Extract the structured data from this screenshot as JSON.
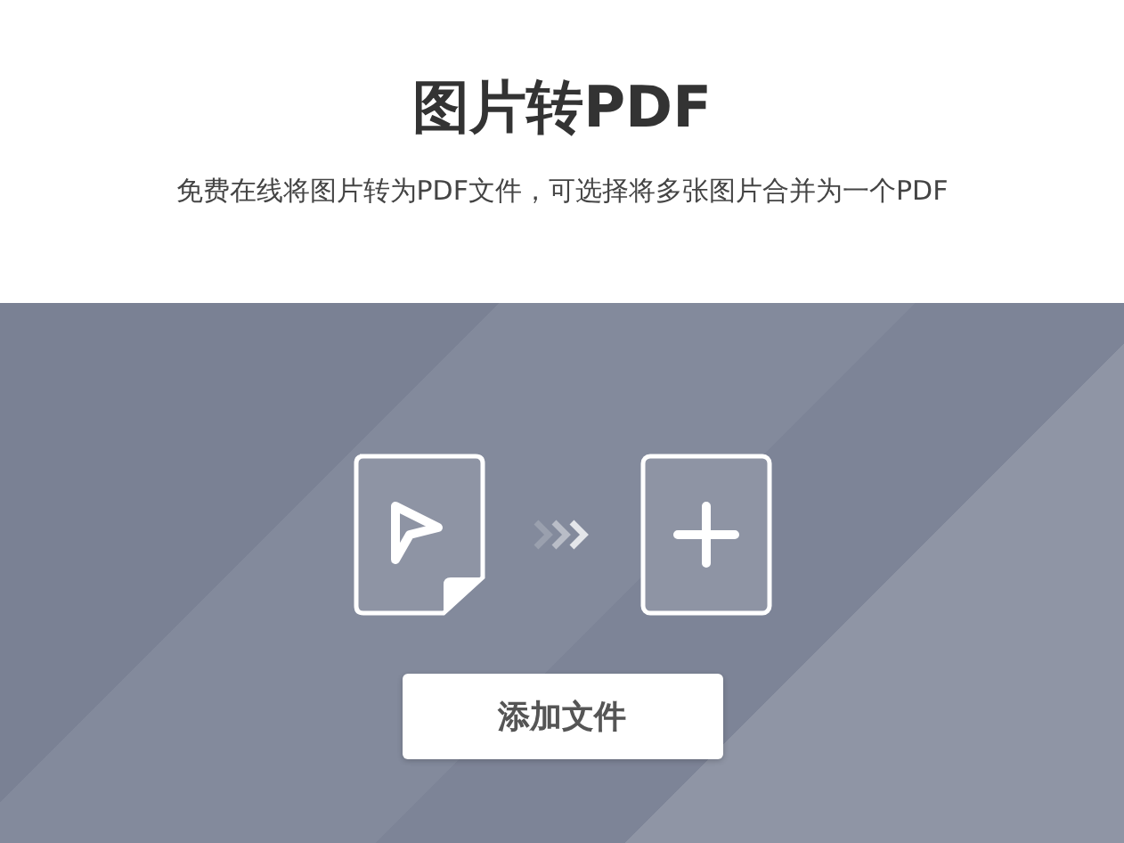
{
  "title": "图片转PDF",
  "subtitle": "免费在线将图片转为PDF文件，可选择将多张图片合并为一个PDF",
  "upload": {
    "button": "添加文件"
  }
}
